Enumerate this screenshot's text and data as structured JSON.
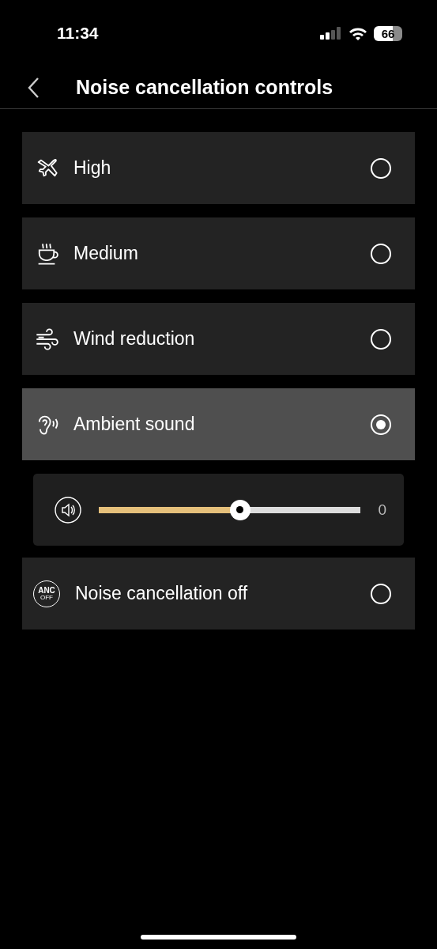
{
  "status_bar": {
    "time": "11:34",
    "battery": "66"
  },
  "header": {
    "title": "Noise cancellation controls"
  },
  "items": [
    {
      "kind": "mode",
      "label": "High",
      "selected": false
    },
    {
      "kind": "mode",
      "label": "Medium",
      "selected": false
    },
    {
      "kind": "mode",
      "label": "Wind reduction",
      "selected": false
    },
    {
      "kind": "mode",
      "label": "Ambient sound",
      "selected": true
    },
    {
      "kind": "slider",
      "level": 0.54,
      "reading": "0"
    },
    {
      "kind": "mode",
      "label": "Noise cancellation off",
      "selected": false,
      "badge_text": [
        "ANC",
        "OFF"
      ]
    }
  ]
}
